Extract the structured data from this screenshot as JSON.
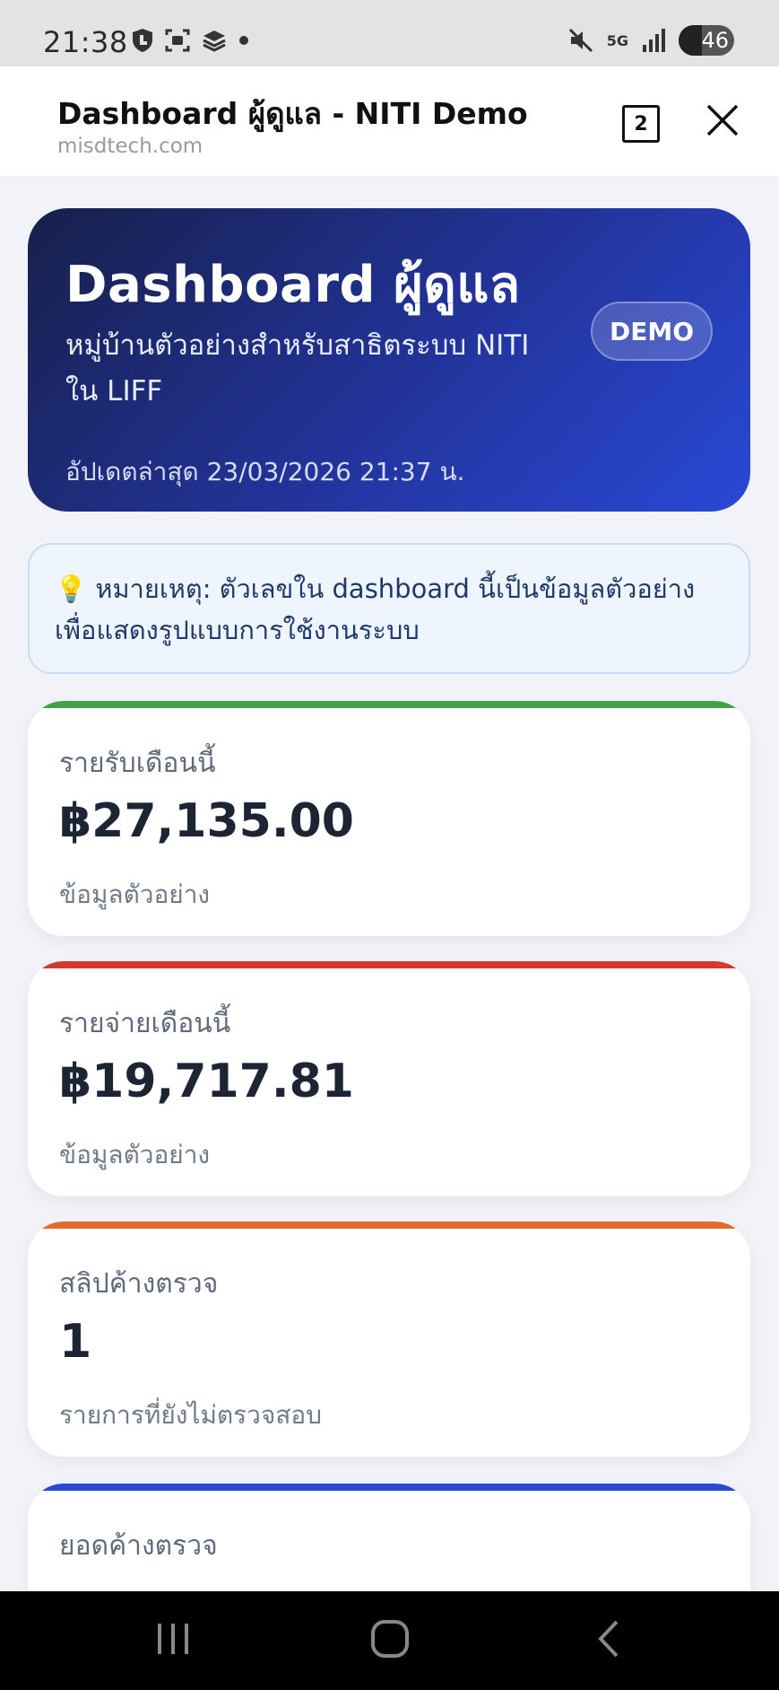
{
  "status_bar": {
    "time": "21:38",
    "network": "5G",
    "battery": "46",
    "icons": [
      "shield-icon",
      "screenshot-icon",
      "stack-icon",
      "dot-icon",
      "mute-icon",
      "signal-icon",
      "battery-icon"
    ]
  },
  "browser": {
    "title": "Dashboard ผู้ดูแล - NITI Demo",
    "url": "misdtech.com",
    "tab_count": "2"
  },
  "hero": {
    "title": "Dashboard ผู้ดูแล",
    "subtitle": "หมู่บ้านตัวอย่างสำหรับสาธิตระบบ NITI ใน LIFF",
    "updated": "อัปเดตล่าสุด 23/03/2026 21:37 น.",
    "badge": "DEMO"
  },
  "note": {
    "text": "💡 หมายเหตุ: ตัวเลขใน dashboard นี้เป็นข้อมูลตัวอย่างเพื่อแสดงรูปแบบการใช้งานระบบ"
  },
  "cards": [
    {
      "label": "รายรับเดือนนี้",
      "value": "฿27,135.00",
      "note": "ข้อมูลตัวอย่าง",
      "accent": "#43a047"
    },
    {
      "label": "รายจ่ายเดือนนี้",
      "value": "฿19,717.81",
      "note": "ข้อมูลตัวอย่าง",
      "accent": "#d23a2e"
    },
    {
      "label": "สลิปค้างตรวจ",
      "value": "1",
      "note": "รายการที่ยังไม่ตรวจสอบ",
      "accent": "#e26b2b"
    },
    {
      "label": "ยอดค้างตรวจ",
      "value": "",
      "note": "",
      "accent": "#2a48d6"
    }
  ],
  "colors": {
    "hero_gradient_start": "#17204a",
    "hero_gradient_end": "#2a48d6",
    "page_background": "#f1f3f8",
    "note_background": "#eef5ff"
  }
}
